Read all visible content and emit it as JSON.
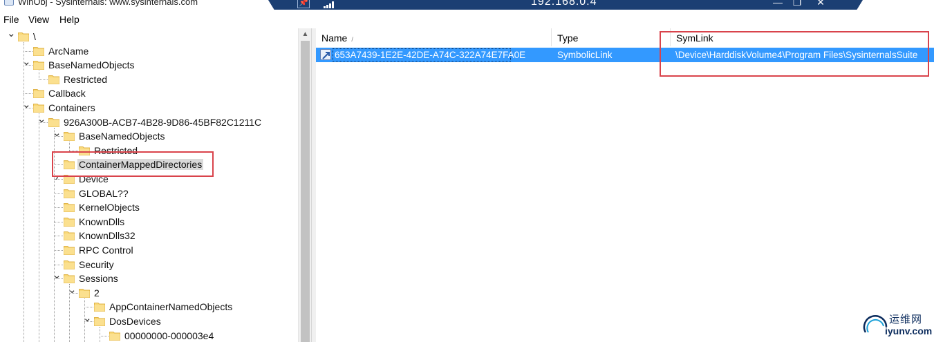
{
  "window": {
    "title": "WinObj - Sysinternals: www.sysinternals.com"
  },
  "remote_bar": {
    "host": "192.168.0.4",
    "pin_glyph": "📌",
    "minimize_glyph": "—",
    "restore_glyph": "❐",
    "close_glyph": "✕"
  },
  "menu": {
    "items": [
      "File",
      "View",
      "Help"
    ]
  },
  "tree": {
    "nodes": [
      {
        "label": "\\",
        "depth": 0,
        "expander": "expanded"
      },
      {
        "label": "ArcName",
        "depth": 1,
        "expander": "none"
      },
      {
        "label": "BaseNamedObjects",
        "depth": 1,
        "expander": "expanded"
      },
      {
        "label": "Restricted",
        "depth": 2,
        "expander": "none"
      },
      {
        "label": "Callback",
        "depth": 1,
        "expander": "none"
      },
      {
        "label": "Containers",
        "depth": 1,
        "expander": "expanded"
      },
      {
        "label": "926A300B-ACB7-4B28-9D86-45BF82C1211C",
        "depth": 2,
        "expander": "expanded"
      },
      {
        "label": "BaseNamedObjects",
        "depth": 3,
        "expander": "expanded"
      },
      {
        "label": "Restricted",
        "depth": 4,
        "expander": "none"
      },
      {
        "label": "ContainerMappedDirectories",
        "depth": 3,
        "expander": "none",
        "selected": true
      },
      {
        "label": "Device",
        "depth": 3,
        "expander": "collapsed"
      },
      {
        "label": "GLOBAL??",
        "depth": 3,
        "expander": "none"
      },
      {
        "label": "KernelObjects",
        "depth": 3,
        "expander": "none"
      },
      {
        "label": "KnownDlls",
        "depth": 3,
        "expander": "none"
      },
      {
        "label": "KnownDlls32",
        "depth": 3,
        "expander": "none"
      },
      {
        "label": "RPC Control",
        "depth": 3,
        "expander": "none"
      },
      {
        "label": "Security",
        "depth": 3,
        "expander": "none"
      },
      {
        "label": "Sessions",
        "depth": 3,
        "expander": "expanded"
      },
      {
        "label": "2",
        "depth": 4,
        "expander": "expanded"
      },
      {
        "label": "AppContainerNamedObjects",
        "depth": 5,
        "expander": "none"
      },
      {
        "label": "DosDevices",
        "depth": 5,
        "expander": "expanded"
      },
      {
        "label": "00000000-000003e4",
        "depth": 6,
        "expander": "none"
      }
    ]
  },
  "list": {
    "columns": [
      {
        "label": "Name",
        "sort_glyph": "/"
      },
      {
        "label": "Type"
      },
      {
        "label": "SymLink"
      }
    ],
    "rows": [
      {
        "name": "653A7439-1E2E-42DE-A74C-322A74E7FA0E",
        "type": "SymbolicLink",
        "symlink": "\\Device\\HarddiskVolume4\\Program Files\\SysinternalsSuite",
        "selected": true
      }
    ]
  },
  "watermark": {
    "cn": "运维网",
    "en": "iyunv.com"
  },
  "colors": {
    "selection": "#3399ff",
    "annotation": "#d9434b",
    "remote_bar": "#1b3f73",
    "folder_fill": "#f8d775",
    "folder_edge": "#e0b44a"
  },
  "icons": {
    "folder": "folder-icon",
    "symlink": "symbolic-link-icon",
    "expanded": "chevron-down-icon",
    "collapsed": "chevron-right-icon"
  }
}
